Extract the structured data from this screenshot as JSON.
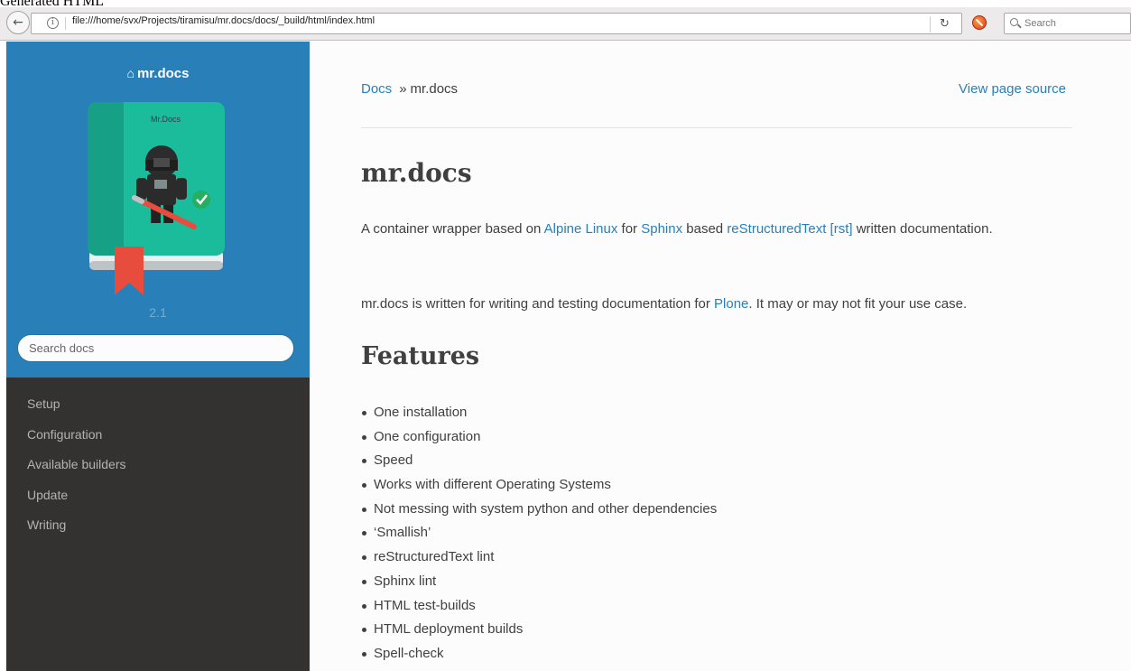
{
  "caption": "Generated HTML",
  "browser": {
    "url": "file:///home/svx/Projects/tiramisu/mr.docs/docs/_build/html/index.html",
    "search_placeholder": "Search"
  },
  "sidebar": {
    "project_name": "mr.docs",
    "logo_label": "Mr.Docs",
    "version": "2.1",
    "search_placeholder": "Search docs",
    "nav": [
      {
        "label": "Setup"
      },
      {
        "label": "Configuration"
      },
      {
        "label": "Available builders"
      },
      {
        "label": "Update"
      },
      {
        "label": "Writing"
      }
    ]
  },
  "content": {
    "breadcrumb": {
      "root": "Docs",
      "separator": "»",
      "current": "mr.docs"
    },
    "view_source": "View page source",
    "title": "mr.docs",
    "para1": {
      "t1": "A container wrapper based on ",
      "link1": "Alpine Linux",
      "t2": " for ",
      "link2": "Sphinx",
      "t3": " based ",
      "link3": "reStructuredText [rst]",
      "t4": " written documentation."
    },
    "para2": {
      "t1": "mr.docs is written for writing and testing documentation for ",
      "link1": "Plone",
      "t2": ". It may or may not fit your use case."
    },
    "features_heading": "Features",
    "features": [
      "One installation",
      "One configuration",
      "Speed",
      "Works with different Operating Systems",
      "Not messing with system python and other dependencies",
      "‘Smallish’",
      "reStructuredText lint",
      "Sphinx lint",
      "HTML test-builds",
      "HTML deployment builds",
      "Spell-check"
    ]
  },
  "colors": {
    "sidebar_blue": "#2980b9",
    "sidebar_dark": "#343131",
    "link": "#2980b9",
    "text": "#404040",
    "book_green": "#1abc9c"
  }
}
